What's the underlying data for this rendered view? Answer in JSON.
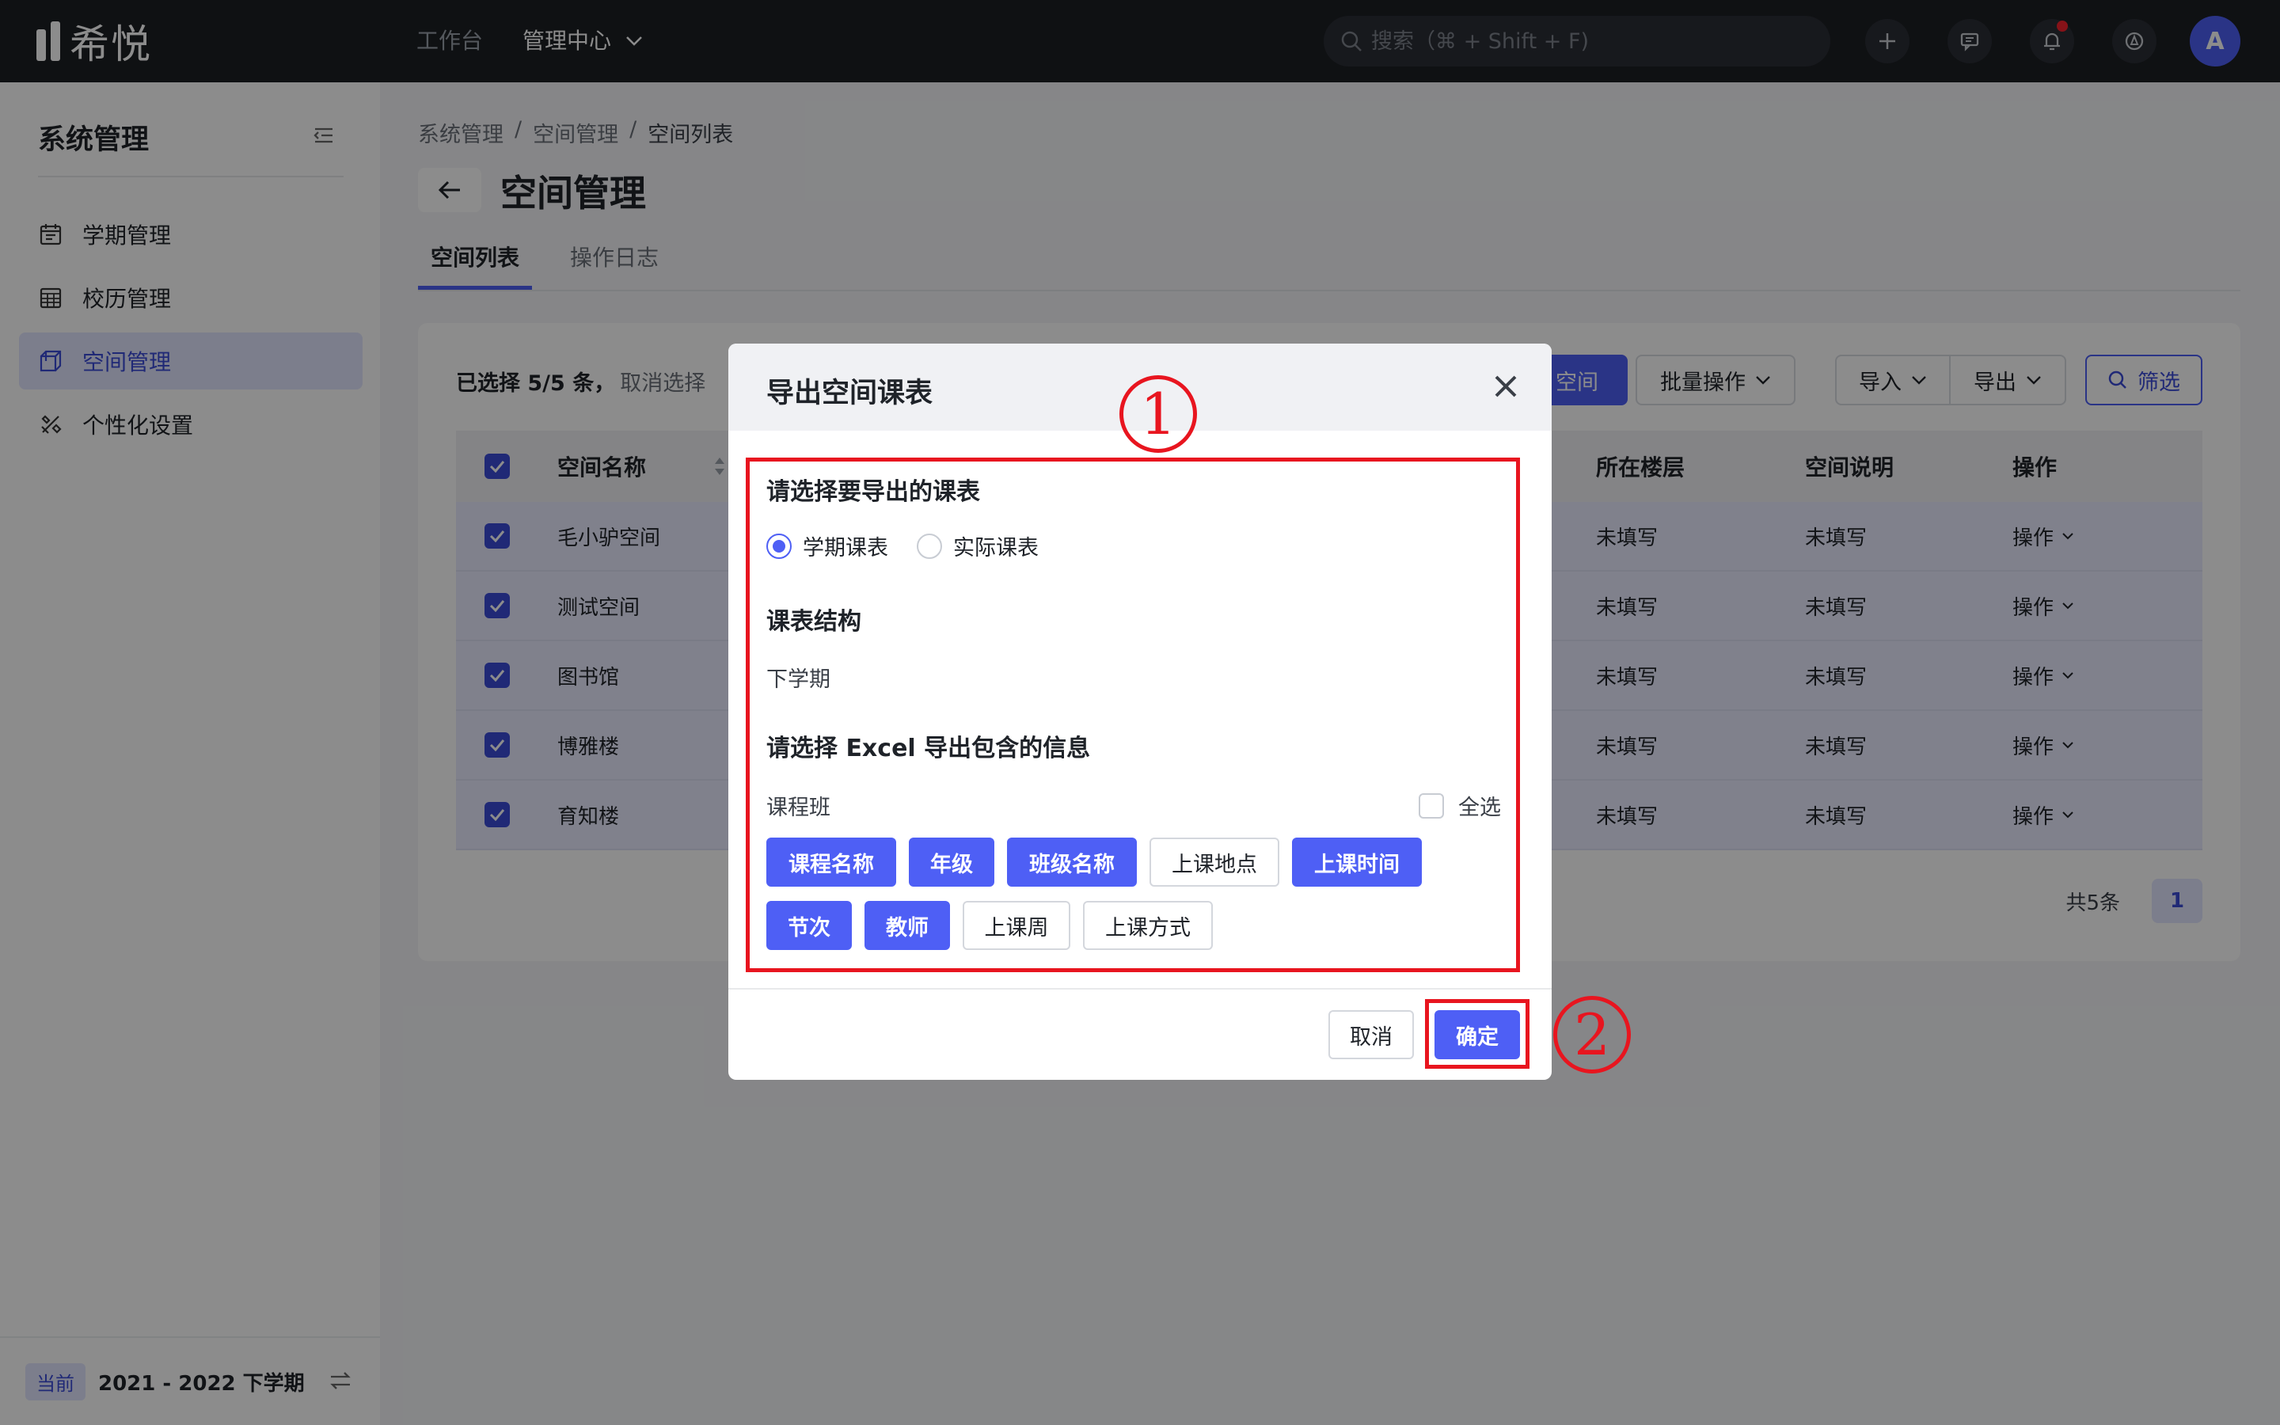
{
  "app": {
    "logo_text": "希悦"
  },
  "topnav": {
    "workbench": "工作台",
    "admin_center": "管理中心"
  },
  "search": {
    "placeholder": "搜索（⌘ + Shift + F)"
  },
  "user": {
    "avatar_letter": "A"
  },
  "sidebar": {
    "title": "系统管理",
    "items": [
      {
        "label": "学期管理",
        "icon": "calendar-icon"
      },
      {
        "label": "校历管理",
        "icon": "calendar-grid-icon"
      },
      {
        "label": "空间管理",
        "icon": "cube-icon",
        "active": true
      },
      {
        "label": "个性化设置",
        "icon": "tools-icon"
      }
    ],
    "current_tag": "当前",
    "current_term": "2021 - 2022 下学期"
  },
  "breadcrumb": [
    "系统管理",
    "空间管理",
    "空间列表"
  ],
  "page": {
    "title": "空间管理"
  },
  "tabs": [
    "空间列表",
    "操作日志"
  ],
  "toolbar": {
    "selected": "已选择 5/5 条，",
    "cancel_select": "取消选择",
    "add_space_partial": "空间",
    "batch": "批量操作",
    "import": "导入",
    "export": "导出",
    "filter": "筛选"
  },
  "table": {
    "headers": {
      "name": "空间名称",
      "floor": "所在楼层",
      "desc": "空间说明",
      "op": "操作"
    },
    "rows": [
      {
        "name": "毛小驴空间",
        "floor": "未填写",
        "desc": "未填写",
        "op": "操作"
      },
      {
        "name": "测试空间",
        "floor": "未填写",
        "desc": "未填写",
        "op": "操作"
      },
      {
        "name": "图书馆",
        "floor": "未填写",
        "desc": "未填写",
        "op": "操作"
      },
      {
        "name": "博雅楼",
        "floor": "未填写",
        "desc": "未填写",
        "op": "操作"
      },
      {
        "name": "育知楼",
        "floor": "未填写",
        "desc": "未填写",
        "op": "操作"
      }
    ],
    "total": "共5条",
    "page": "1"
  },
  "modal": {
    "title": "导出空间课表",
    "section1": "请选择要导出的课表",
    "radio_semester": "学期课表",
    "radio_actual": "实际课表",
    "section2": "课表结构",
    "structure_value": "下学期",
    "section3": "请选择 Excel 导出包含的信息",
    "group_label": "课程班",
    "select_all": "全选",
    "chips": [
      {
        "label": "课程名称",
        "on": true
      },
      {
        "label": "年级",
        "on": true
      },
      {
        "label": "班级名称",
        "on": true
      },
      {
        "label": "上课地点",
        "on": false
      },
      {
        "label": "上课时间",
        "on": true
      },
      {
        "label": "节次",
        "on": true
      },
      {
        "label": "教师",
        "on": true
      },
      {
        "label": "上课周",
        "on": false
      },
      {
        "label": "上课方式",
        "on": false
      }
    ],
    "cancel": "取消",
    "ok": "确定"
  },
  "annotations": {
    "callout1": "1",
    "callout2": "2",
    "color": "#e8151f"
  },
  "colors": {
    "accent": "#4e5ff5",
    "topbar": "#1d1f24"
  }
}
